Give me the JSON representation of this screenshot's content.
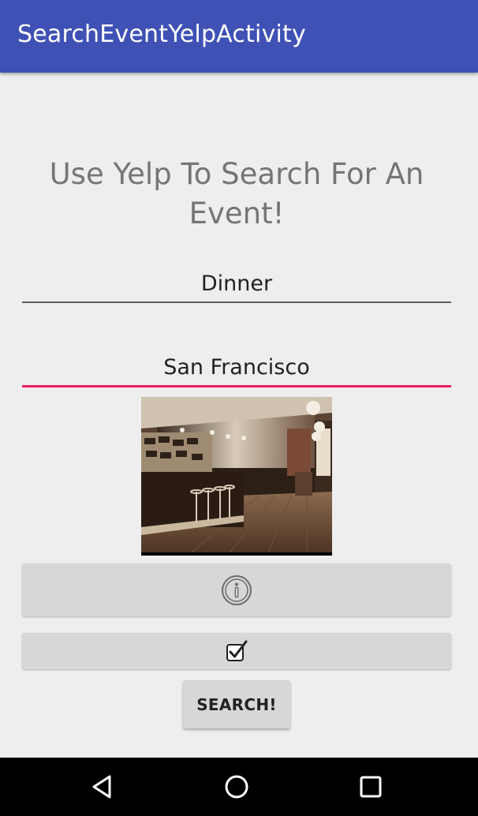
{
  "app_bar": {
    "title": "SearchEventYelpActivity",
    "color": "#3F51B5"
  },
  "main": {
    "heading": "Use Yelp To Search For An Event!",
    "search_term": {
      "value": "Dinner",
      "placeholder": ""
    },
    "location": {
      "value": "San Francisco",
      "placeholder": "",
      "focused": true,
      "accent_color": "#E91E63"
    },
    "image": {
      "description": "restaurant-interior-sepia-photo"
    },
    "info_button": {
      "icon": "info-icon"
    },
    "checkbox_button": {
      "icon": "checkbox-checked-icon",
      "checked": true
    },
    "search_button": {
      "label": "SEARCH!"
    }
  },
  "nav_bar": {
    "back_icon": "back-triangle-icon",
    "home_icon": "home-circle-icon",
    "recent_icon": "recent-apps-square-icon"
  }
}
